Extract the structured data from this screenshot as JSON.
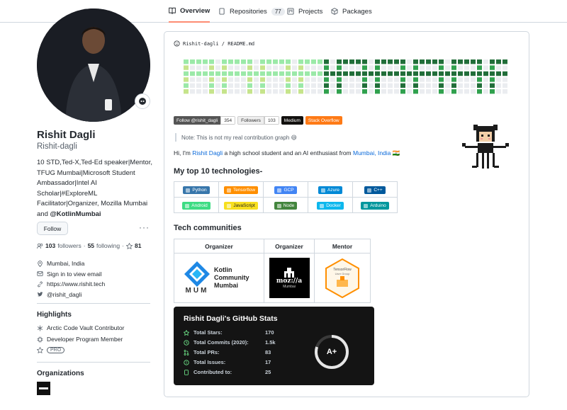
{
  "tabs": [
    {
      "label": "Overview",
      "icon": "book-icon",
      "active": true
    },
    {
      "label": "Repositories",
      "icon": "repo-icon",
      "count": "77"
    },
    {
      "label": "Projects",
      "icon": "project-icon"
    },
    {
      "label": "Packages",
      "icon": "package-icon"
    }
  ],
  "profile": {
    "name": "Rishit Dagli",
    "login": "Rishit-dagli",
    "bio": "10 STD,Ted-X,Ted-Ed speaker|Mentor, TFUG Mumbai|Microsoft Student Ambassador|Intel AI Scholar|#ExploreML Facilitator|Organizer, Mozilla Mumbai and",
    "bio_handle": "@KotlinMumbai",
    "follow_label": "Follow",
    "more_label": "···",
    "followers_count": "103",
    "followers_label": "followers",
    "following_count": "55",
    "following_label": "following",
    "stars_count": "81",
    "separator": "·",
    "location": "Mumbai, India",
    "email": "Sign in to view email",
    "website": "https://www.rishit.tech",
    "twitter": "@rishit_dagli"
  },
  "highlights": {
    "title": "Highlights",
    "items": [
      "Arctic Code Vault Contributor",
      "Developer Program Member"
    ],
    "pro": "PRO"
  },
  "organizations": {
    "title": "Organizations"
  },
  "readme": {
    "path": "Rishit-dagli / README.md",
    "badges": [
      {
        "left": "Follow @rishit_dagli",
        "right": "354",
        "color": "#1da1f2"
      },
      {
        "left": "Followers",
        "right": "103",
        "color": "#333333"
      },
      {
        "left": "Medium",
        "right": "",
        "color": "#12100e"
      },
      {
        "left": "Stack Overflow",
        "right": "",
        "color": "#fe7a16"
      }
    ],
    "note": "Note: This is not my real contribution graph 😄",
    "intro_pre": "Hi, I'm ",
    "intro_name": "Rishit Dagli",
    "intro_mid": " a high school student and an AI enthusiast from ",
    "intro_place": "Mumbai, India",
    "intro_flag": "🇮🇳",
    "tech_title": "My top 10 technologies-",
    "tech": [
      [
        {
          "label": "Python",
          "color": "#3776ab"
        },
        {
          "label": "Tensorflow",
          "color": "#ff8f00"
        },
        {
          "label": "GCP",
          "color": "#4285f4"
        },
        {
          "label": "Azure",
          "color": "#0089d6"
        },
        {
          "label": "C++",
          "color": "#00599c"
        }
      ],
      [
        {
          "label": "Android",
          "color": "#3ddc84"
        },
        {
          "label": "JavaScript",
          "color": "#f7df1e"
        },
        {
          "label": "Node",
          "color": "#43853d"
        },
        {
          "label": "Docker",
          "color": "#0db7ed"
        },
        {
          "label": "Arduino",
          "color": "#00979d"
        }
      ]
    ],
    "communities_title": "Tech communities",
    "communities": [
      {
        "role": "Organizer",
        "logo_text": "Kotlin Community Mumbai",
        "sub": "MUM"
      },
      {
        "role": "Organizer",
        "logo_text": "moz://a",
        "sub": "Mumbai"
      },
      {
        "role": "Mentor",
        "logo_text": "TensorFlow",
        "sub": "User Group"
      }
    ],
    "stats": {
      "title": "Rishit Dagli's GitHub Stats",
      "rows": [
        {
          "label": "Total Stars:",
          "value": "170",
          "icon": "star-icon"
        },
        {
          "label": "Total Commits (2020):",
          "value": "1.5k",
          "icon": "history-icon"
        },
        {
          "label": "Total PRs:",
          "value": "83",
          "icon": "pull-request-icon"
        },
        {
          "label": "Total Issues:",
          "value": "17",
          "icon": "issue-icon"
        },
        {
          "label": "Contributed to:",
          "value": "25",
          "icon": "repo-icon"
        }
      ],
      "grade": "A+",
      "grade_progress": 0.8
    }
  }
}
